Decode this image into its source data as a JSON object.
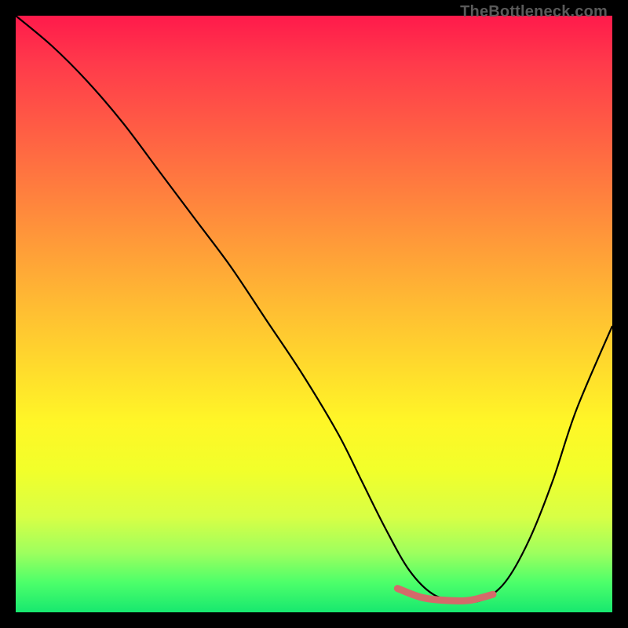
{
  "watermark": "TheBottleneck.com",
  "colors": {
    "background": "#000000",
    "curve": "#000000",
    "accent": "#d46a6a"
  },
  "chart_data": {
    "type": "line",
    "title": "",
    "xlabel": "",
    "ylabel": "",
    "x_range": [
      0,
      100
    ],
    "y_range": [
      0,
      100
    ],
    "note": "No axes or tick labels are rendered; values are normalized 0-100. The curve depicts a bottleneck-style valley.",
    "series": [
      {
        "name": "bottleneck-curve",
        "x": [
          0,
          6,
          12,
          18,
          24,
          30,
          36,
          42,
          48,
          54,
          58,
          62,
          66,
          70,
          74,
          78,
          82,
          86,
          90,
          94,
          100
        ],
        "y": [
          100,
          95,
          89,
          82,
          74,
          66,
          58,
          49,
          40,
          30,
          22,
          14,
          7,
          3,
          2,
          2,
          5,
          12,
          22,
          34,
          48
        ]
      },
      {
        "name": "accent-segment",
        "x": [
          64,
          68,
          72,
          76,
          80
        ],
        "y": [
          4,
          2.5,
          2,
          2,
          3
        ]
      }
    ]
  }
}
